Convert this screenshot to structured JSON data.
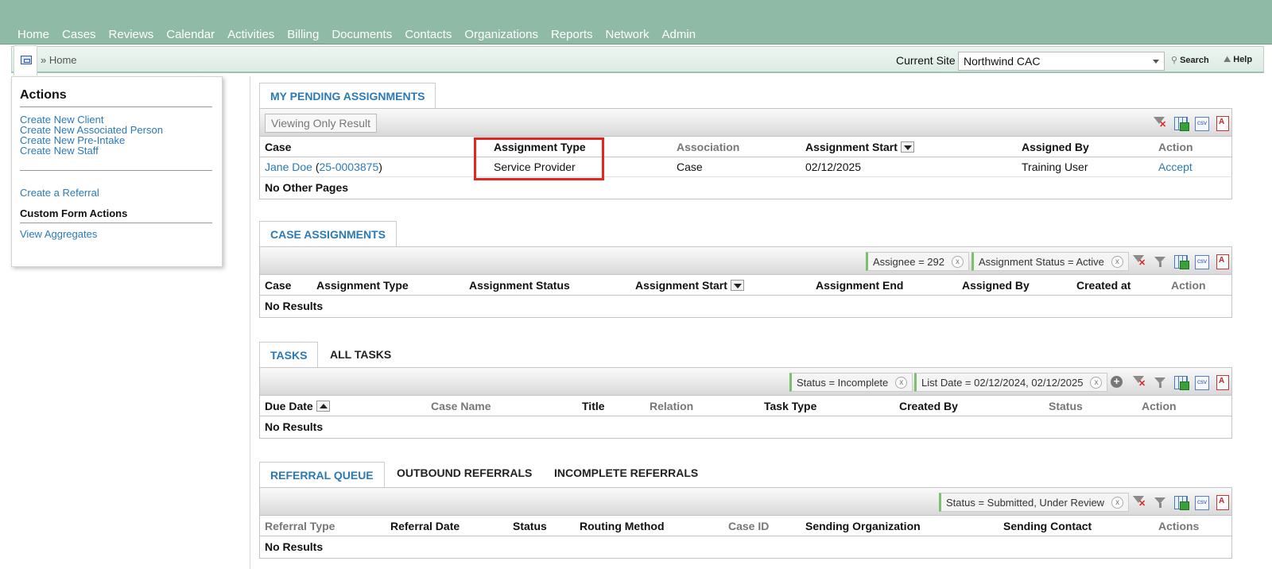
{
  "nav": {
    "items": [
      "Home",
      "Cases",
      "Reviews",
      "Calendar",
      "Activities",
      "Billing",
      "Documents",
      "Contacts",
      "Organizations",
      "Reports",
      "Network",
      "Admin"
    ]
  },
  "breadcrumb": {
    "icon": "home-page-icon",
    "text": "» Home"
  },
  "header": {
    "current_site_label": "Current Site",
    "current_site_value": "Northwind CAC",
    "search_label": "Search",
    "help_label": "Help"
  },
  "actions_panel": {
    "title": "Actions",
    "links_group1": [
      "Create New Client",
      "Create New Associated Person",
      "Create New Pre-Intake",
      "Create New Staff"
    ],
    "referral_link": "Create a Referral",
    "custom_form_label": "Custom Form Actions",
    "aggregates_link": "View Aggregates"
  },
  "pending": {
    "tab": "MY PENDING ASSIGNMENTS",
    "viewing_button": "Viewing Only Result",
    "columns": [
      "Case",
      "Assignment Type",
      "Association",
      "Assignment Start",
      "Assigned By",
      "Action"
    ],
    "row": {
      "case_name": "Jane Doe",
      "case_open": "(",
      "case_number": "25-0003875",
      "case_close": ")",
      "assignment_type": "Service Provider",
      "association": "Case",
      "assignment_start": "02/12/2025",
      "assigned_by": "Training User",
      "action": "Accept"
    },
    "footer": "No Other Pages"
  },
  "case_assignments": {
    "tab": "CASE ASSIGNMENTS",
    "filters": [
      "Assignee = 292",
      "Assignment Status = Active"
    ],
    "columns": [
      "Case",
      "Assignment Type",
      "Assignment Status",
      "Assignment Start",
      "Assignment End",
      "Assigned By",
      "Created at",
      "Action"
    ],
    "empty": "No Results"
  },
  "tasks": {
    "tabs": [
      "TASKS",
      "ALL TASKS"
    ],
    "filters": [
      "Status = Incomplete",
      "List Date = 02/12/2024, 02/12/2025"
    ],
    "columns": [
      "Due Date",
      "Case Name",
      "Title",
      "Relation",
      "Task Type",
      "Created By",
      "Status",
      "Action"
    ],
    "empty": "No Results"
  },
  "referrals": {
    "tabs": [
      "REFERRAL QUEUE",
      "OUTBOUND REFERRALS",
      "INCOMPLETE REFERRALS"
    ],
    "filters": [
      "Status = Submitted, Under Review"
    ],
    "columns": [
      "Referral Type",
      "Referral Date",
      "Status",
      "Routing Method",
      "Case ID",
      "Sending Organization",
      "Sending Contact",
      "Actions"
    ],
    "empty": "No Results"
  },
  "filter_remove_glyph": "x",
  "colors": {
    "nav_bg": "#8fbaa5",
    "link": "#2a7ab8",
    "highlight": "#e8241b",
    "filter_accent": "#7ac06f"
  }
}
